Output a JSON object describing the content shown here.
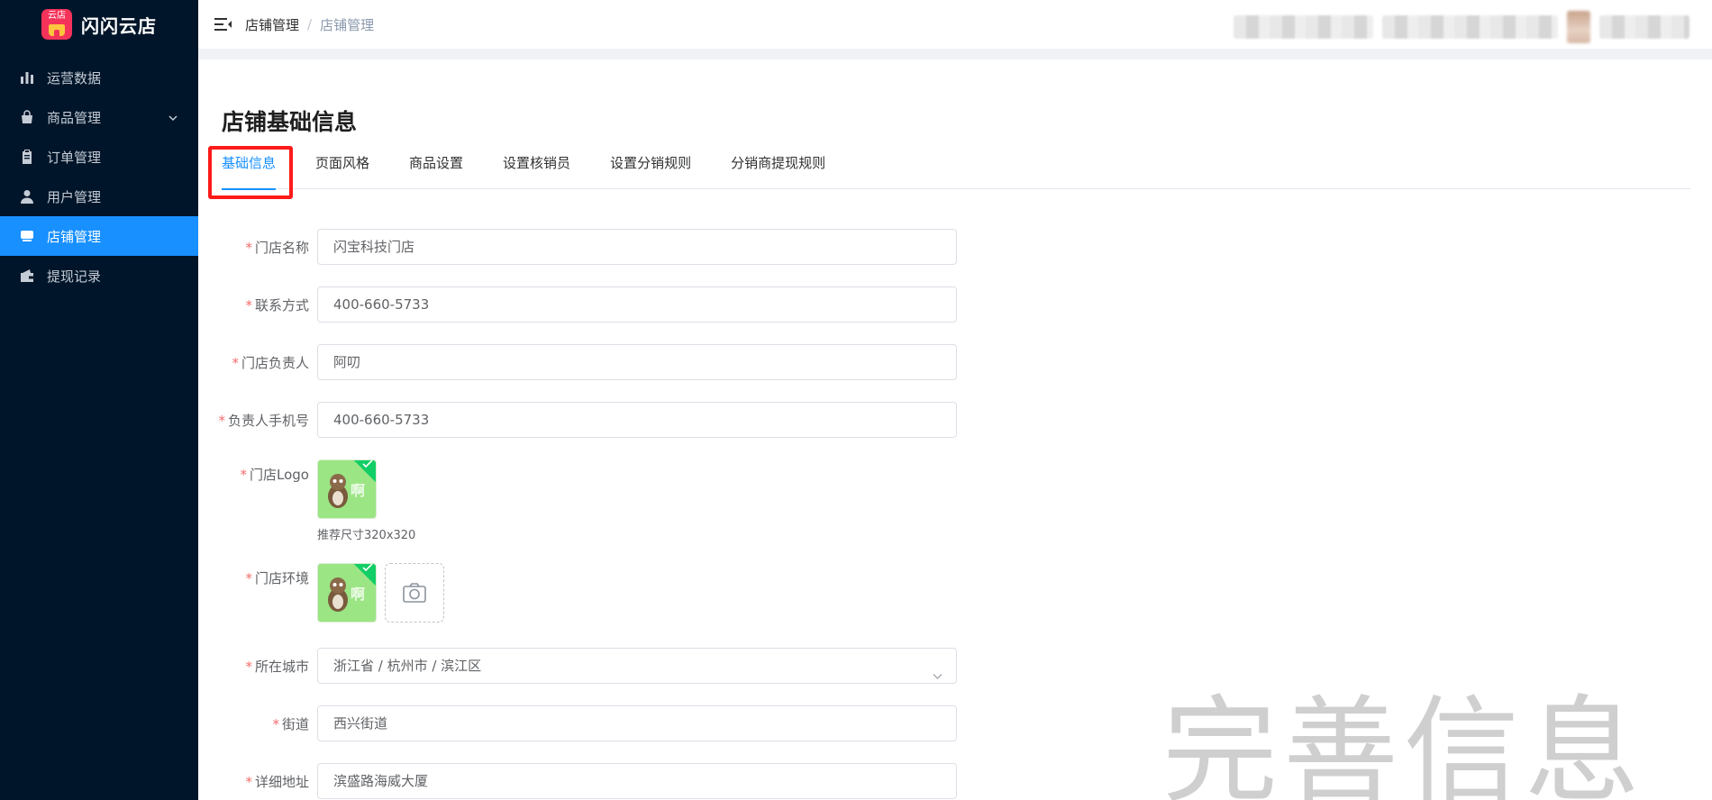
{
  "brand": {
    "name": "闪闪云店",
    "badge_text": "云店"
  },
  "sidebar": {
    "items": [
      {
        "label": "运营数据",
        "icon": "bar-chart-icon"
      },
      {
        "label": "商品管理",
        "icon": "shopping-bag-icon",
        "has_submenu": true
      },
      {
        "label": "订单管理",
        "icon": "clipboard-icon"
      },
      {
        "label": "用户管理",
        "icon": "user-icon"
      },
      {
        "label": "店铺管理",
        "icon": "store-icon",
        "active": true
      },
      {
        "label": "提现记录",
        "icon": "wallet-icon"
      }
    ]
  },
  "header": {
    "breadcrumb": [
      "店铺管理",
      "店铺管理"
    ],
    "separator": "/"
  },
  "page": {
    "title": "店铺基础信息",
    "tabs": [
      "基础信息",
      "页面风格",
      "商品设置",
      "设置核销员",
      "设置分销规则",
      "分销商提现规则"
    ],
    "active_tab": 0
  },
  "form": {
    "required_mark": "*",
    "store_name": {
      "label": "门店名称",
      "value": "闪宝科技门店"
    },
    "contact": {
      "label": "联系方式",
      "value": "400-660-5733"
    },
    "manager": {
      "label": "门店负责人",
      "value": "阿叨"
    },
    "manager_phone": {
      "label": "负责人手机号",
      "value": "400-660-5733"
    },
    "logo": {
      "label": "门店Logo",
      "hint": "推荐尺寸320x320",
      "thumb_text": "啊"
    },
    "environment": {
      "label": "门店环境",
      "thumb_text": "啊"
    },
    "city": {
      "label": "所在城市",
      "value": "浙江省 / 杭州市 / 滨江区"
    },
    "street": {
      "label": "街道",
      "value": "西兴街道"
    },
    "address": {
      "label": "详细地址",
      "value": "滨盛路海威大厦"
    }
  },
  "watermark": "完善信息",
  "colors": {
    "primary": "#1890ff",
    "sidebar_bg": "#001529",
    "highlight": "#ff1a1a",
    "required": "#f56c6c"
  }
}
